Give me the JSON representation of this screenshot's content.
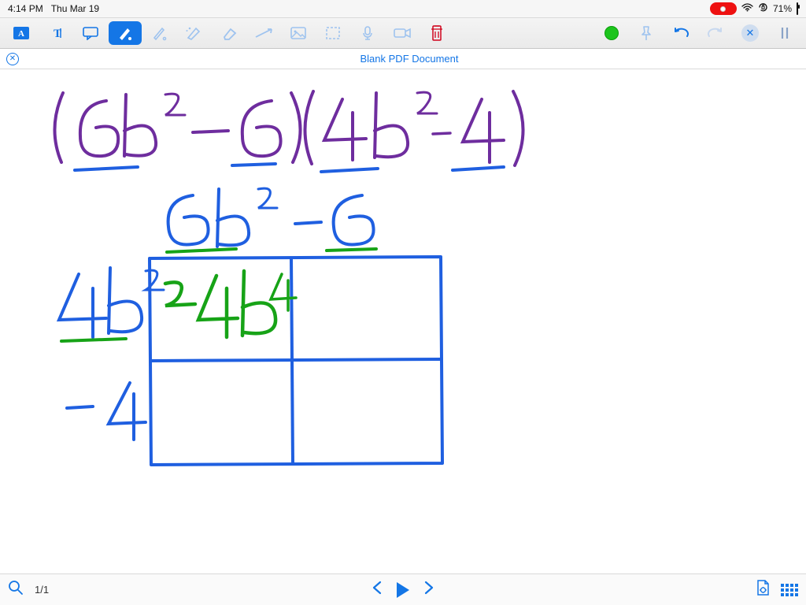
{
  "status": {
    "time": "4:14 PM",
    "date": "Thu Mar 19",
    "battery": "71%"
  },
  "toolbar": {
    "tools": [
      "text-box",
      "type",
      "comment",
      "pen",
      "pen-thin",
      "highlighter",
      "eraser",
      "line",
      "image",
      "select",
      "mic",
      "video",
      "trash"
    ],
    "active_index": 3
  },
  "document": {
    "title": "Blank PDF Document"
  },
  "handwriting": {
    "expression": "(6b² − 6)(4b² − 4)",
    "col_headers": [
      "6b²",
      "−6"
    ],
    "row_headers": [
      "4b²",
      "−4"
    ],
    "cells": [
      [
        "24b⁴",
        ""
      ],
      [
        "",
        ""
      ]
    ],
    "colors": {
      "expr": "#6e2d9e",
      "grid": "#1f5fe0",
      "labels": "#1f5fe0",
      "cell": "#17a317",
      "underline": "#17a317"
    }
  },
  "footer": {
    "page": "1/1"
  },
  "icons": {
    "textbox": "A",
    "type": "T",
    "pen": "pen",
    "eraser": "eraser",
    "line": "line",
    "image": "img",
    "select": "sel",
    "mic": "mic",
    "video": "vid",
    "trash": "trash",
    "pin": "pin",
    "undo": "undo",
    "redo": "redo",
    "close": "x",
    "pause": "||"
  }
}
